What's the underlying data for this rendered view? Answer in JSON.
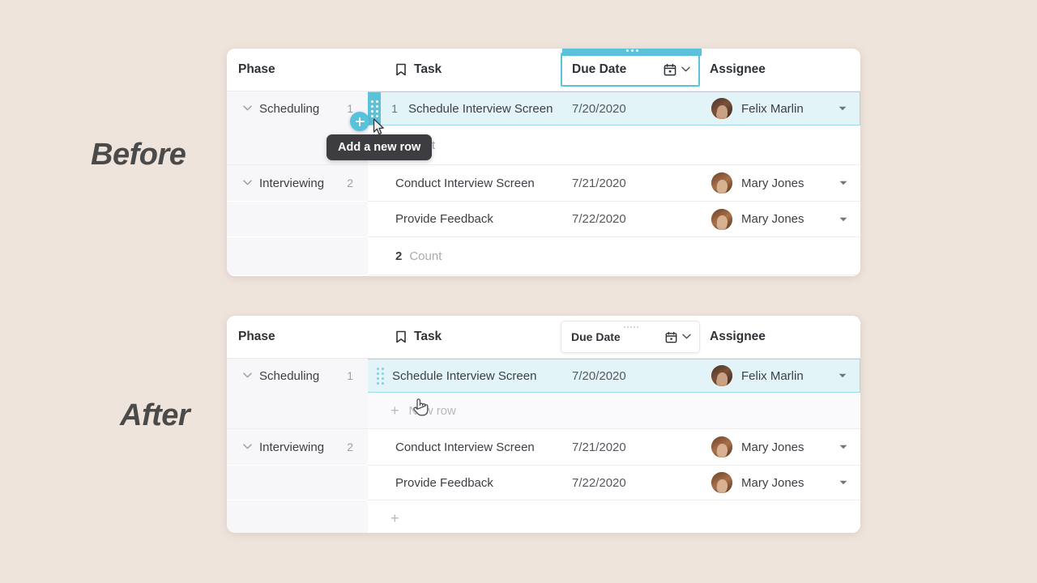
{
  "page": {
    "background_color": "#efe4dc",
    "accent_color": "#5bc2da",
    "highlight_row_color": "#e2f4f8"
  },
  "labels": {
    "before": "Before",
    "after": "After"
  },
  "table": {
    "columns": [
      {
        "key": "phase",
        "label": "Phase",
        "icon": null
      },
      {
        "key": "task",
        "label": "Task",
        "icon": "bookmark-icon"
      },
      {
        "key": "due_date",
        "label": "Due Date",
        "icon": "calendar-icon"
      },
      {
        "key": "assignee",
        "label": "Assignee",
        "icon": null
      }
    ]
  },
  "before": {
    "due_date_header": {
      "label": "Due Date",
      "selected": true,
      "calendar_icon": "calendar-icon",
      "caret_icon": "chevron-down-icon",
      "drag_handle_icon": "drag-dots-icon"
    },
    "groups": [
      {
        "name": "Scheduling",
        "count": "1",
        "chevron_icon": "chevron-down-icon",
        "rows": [
          {
            "number": "1",
            "task": "Schedule Interview Screen",
            "due_date": "7/20/2020",
            "assignee": "Felix Marlin",
            "avatar": "avatar-felix",
            "caret_icon": "chevron-down-icon",
            "selected": true,
            "drag_handle_icon": "drag-dots-icon"
          }
        ],
        "summary": {
          "value": "",
          "label": "Count"
        }
      },
      {
        "name": "Interviewing",
        "count": "2",
        "chevron_icon": "chevron-down-icon",
        "rows": [
          {
            "number": "",
            "task": "Conduct Interview Screen",
            "due_date": "7/21/2020",
            "assignee": "Mary Jones",
            "avatar": "avatar-mary",
            "caret_icon": "chevron-down-icon",
            "selected": false
          },
          {
            "number": "",
            "task": "Provide Feedback",
            "due_date": "7/22/2020",
            "assignee": "Mary Jones",
            "avatar": "avatar-mary",
            "caret_icon": "chevron-down-icon",
            "selected": false
          }
        ],
        "summary": {
          "value": "2",
          "label": "Count"
        }
      }
    ],
    "add_row_button": {
      "icon": "plus-circle-icon",
      "tooltip": "Add a new row"
    },
    "cursor": "arrow-cursor"
  },
  "after": {
    "due_date_header": {
      "label": "Due Date",
      "selected": false,
      "calendar_icon": "calendar-icon",
      "caret_icon": "chevron-down-icon",
      "drag_handle_icon": "drag-dots-icon"
    },
    "groups": [
      {
        "name": "Scheduling",
        "count": "1",
        "chevron_icon": "chevron-down-icon",
        "rows": [
          {
            "number": "",
            "task": "Schedule Interview Screen",
            "due_date": "7/20/2020",
            "assignee": "Felix Marlin",
            "avatar": "avatar-felix",
            "caret_icon": "chevron-down-icon",
            "selected": true,
            "drag_handle_icon": "drag-dots-icon"
          }
        ],
        "new_row": {
          "plus_icon": "plus-icon",
          "label": "New row"
        }
      },
      {
        "name": "Interviewing",
        "count": "2",
        "chevron_icon": "chevron-down-icon",
        "rows": [
          {
            "number": "",
            "task": "Conduct Interview Screen",
            "due_date": "7/21/2020",
            "assignee": "Mary Jones",
            "avatar": "avatar-mary",
            "caret_icon": "chevron-down-icon",
            "selected": false
          },
          {
            "number": "",
            "task": "Provide Feedback",
            "due_date": "7/22/2020",
            "assignee": "Mary Jones",
            "avatar": "avatar-mary",
            "caret_icon": "chevron-down-icon",
            "selected": false
          }
        ],
        "new_row": {
          "plus_icon": "plus-icon",
          "label": ""
        }
      }
    ],
    "cursor": "pointer-hand-cursor"
  }
}
